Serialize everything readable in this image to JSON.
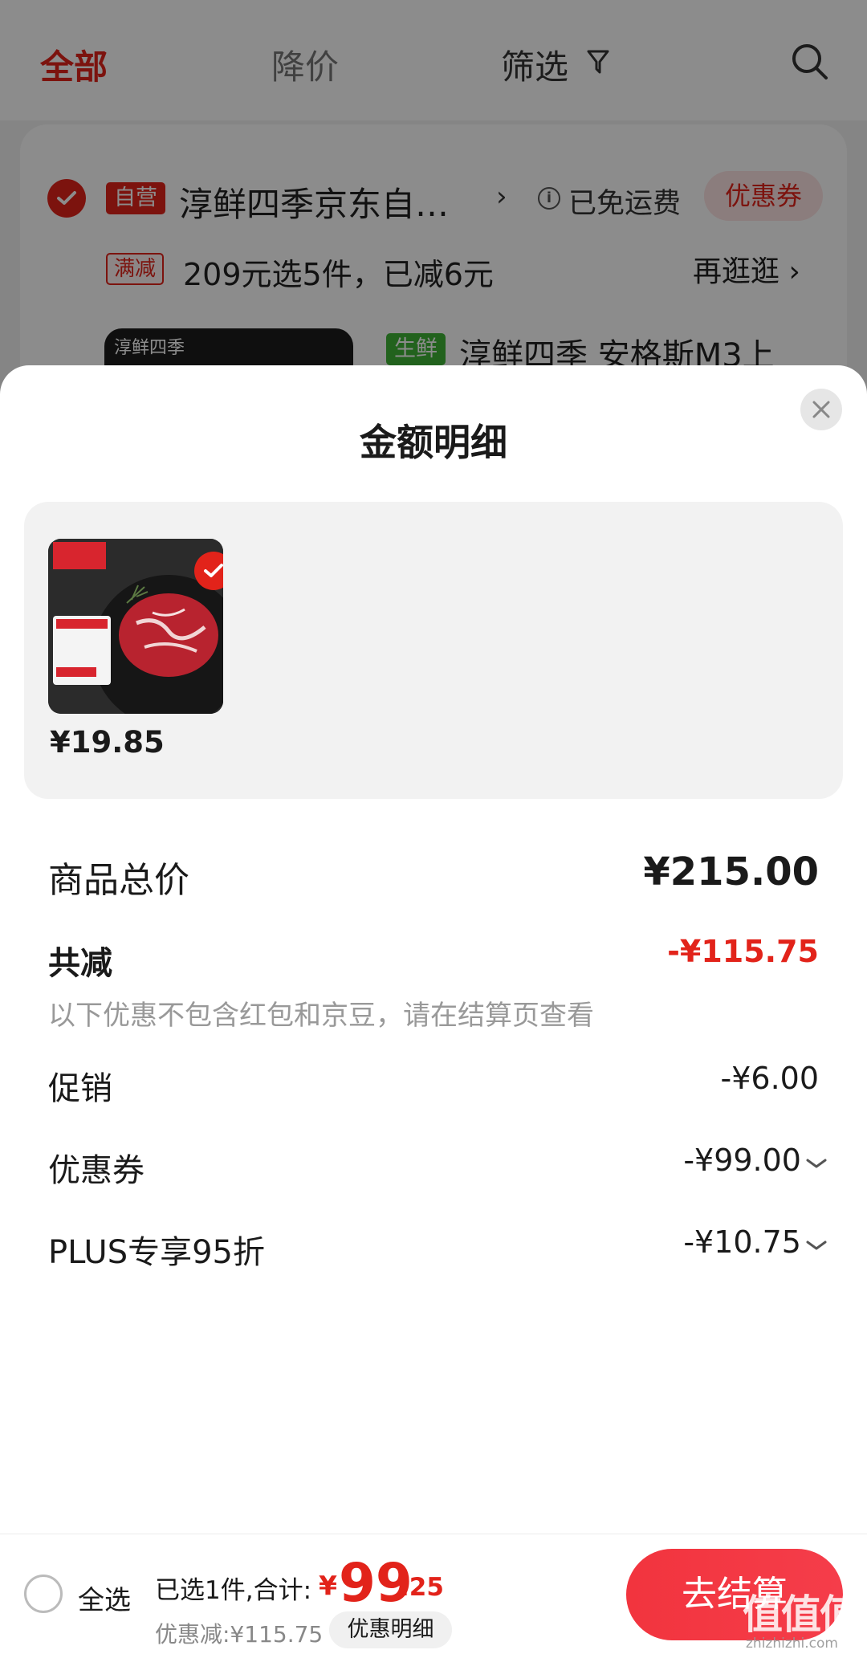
{
  "topbar": {
    "tab_all": "全部",
    "tab_price_drop": "降价",
    "tab_filter": "筛选"
  },
  "store": {
    "self_tag": "自营",
    "name": "淳鲜四季京东自…",
    "free_shipping": "已免运费",
    "coupon_label": "优惠券",
    "promo_tag": "满减",
    "promo_text": "209元选5件，已减6元",
    "browse_more": "再逛逛",
    "product_fresh_tag": "生鲜",
    "product_name": "淳鲜四季 安格斯M3上",
    "thumb_logo": "淳鲜四季"
  },
  "sheet": {
    "title": "金额明细",
    "item_price": "¥19.85",
    "total_label": "商品总价",
    "total_value": "¥215.00",
    "reduce_label": "共减",
    "reduce_value": "-¥115.75",
    "note": "以下优惠不包含红包和京豆，请在结算页查看",
    "promo_label": "促销",
    "promo_value": "-¥6.00",
    "coupon_label": "优惠券",
    "coupon_value": "-¥99.00",
    "plus_label": "PLUS专享95折",
    "plus_value": "-¥10.75"
  },
  "bottom_bar": {
    "select_all": "全选",
    "selected_summary": "已选1件,合计:",
    "currency": "¥",
    "total_int": "99",
    "total_dec": ".25",
    "discount": "优惠减:¥115.75",
    "detail_button": "优惠明细",
    "checkout_button": "去结算"
  },
  "watermark": {
    "logo": "值值值",
    "url": "zhizhizhi.com"
  },
  "colors": {
    "accent": "#e2231a",
    "fresh": "#3eb236",
    "muted": "#999999"
  }
}
